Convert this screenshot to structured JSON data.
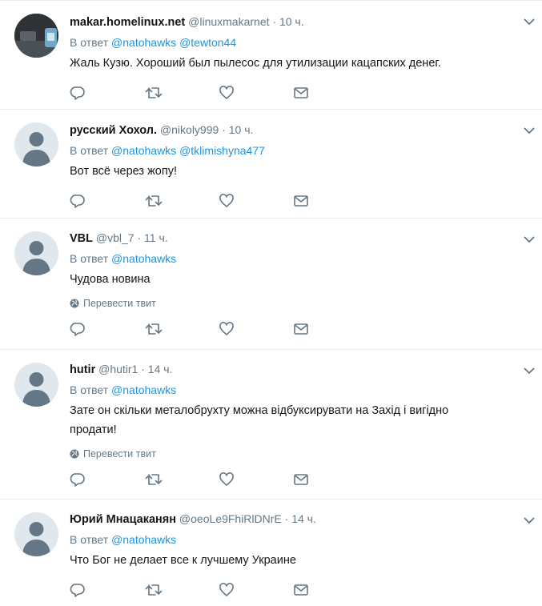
{
  "reply_prefix": "В ответ",
  "translate_label": "Перевести твит",
  "tweets": [
    {
      "fullname": "makar.homelinux.net",
      "username": "@linuxmakarnet",
      "sep": "·",
      "time": "10 ч.",
      "mentions": [
        "@natohawks",
        "@tewton44"
      ],
      "text": "Жаль Кузю. Хороший был пылесос для утилизации кацапских денег."
    },
    {
      "fullname": "русский Хохол.",
      "username": "@nikoly999",
      "sep": "·",
      "time": "10 ч.",
      "mentions": [
        "@natohawks",
        "@tklimishyna477"
      ],
      "text": "Вот всё через жопу!"
    },
    {
      "fullname": "VBL",
      "username": "@vbl_7",
      "sep": "·",
      "time": "11 ч.",
      "mentions": [
        "@natohawks"
      ],
      "text": "Чудова новина"
    },
    {
      "fullname": "hutir",
      "username": "@hutir1",
      "sep": "·",
      "time": "14 ч.",
      "mentions": [
        "@natohawks"
      ],
      "text_lines": [
        "Зате он скільки металобрухту можна відбуксирувати на Захід і вигідно",
        "продати!"
      ]
    },
    {
      "fullname": "Юрий Мнацаканян",
      "username": "@oeoLe9FhiRlDNrE",
      "sep": "·",
      "time": "14 ч.",
      "mentions": [
        "@natohawks"
      ],
      "text": "Что Бог не делает все к лучшему Украине"
    }
  ],
  "colors": {
    "link": "#1b95e0",
    "secondary_text": "#657786",
    "icon": "#657786",
    "divider": "#e6ecf0",
    "avatar_placeholder": "#e1e8ed",
    "avatar_silhouette": "#657786"
  },
  "icons": [
    "chevron-down-icon",
    "reply-icon",
    "retweet-icon",
    "like-icon",
    "direct-message-icon",
    "globe-icon",
    "default-avatar-icon"
  ]
}
